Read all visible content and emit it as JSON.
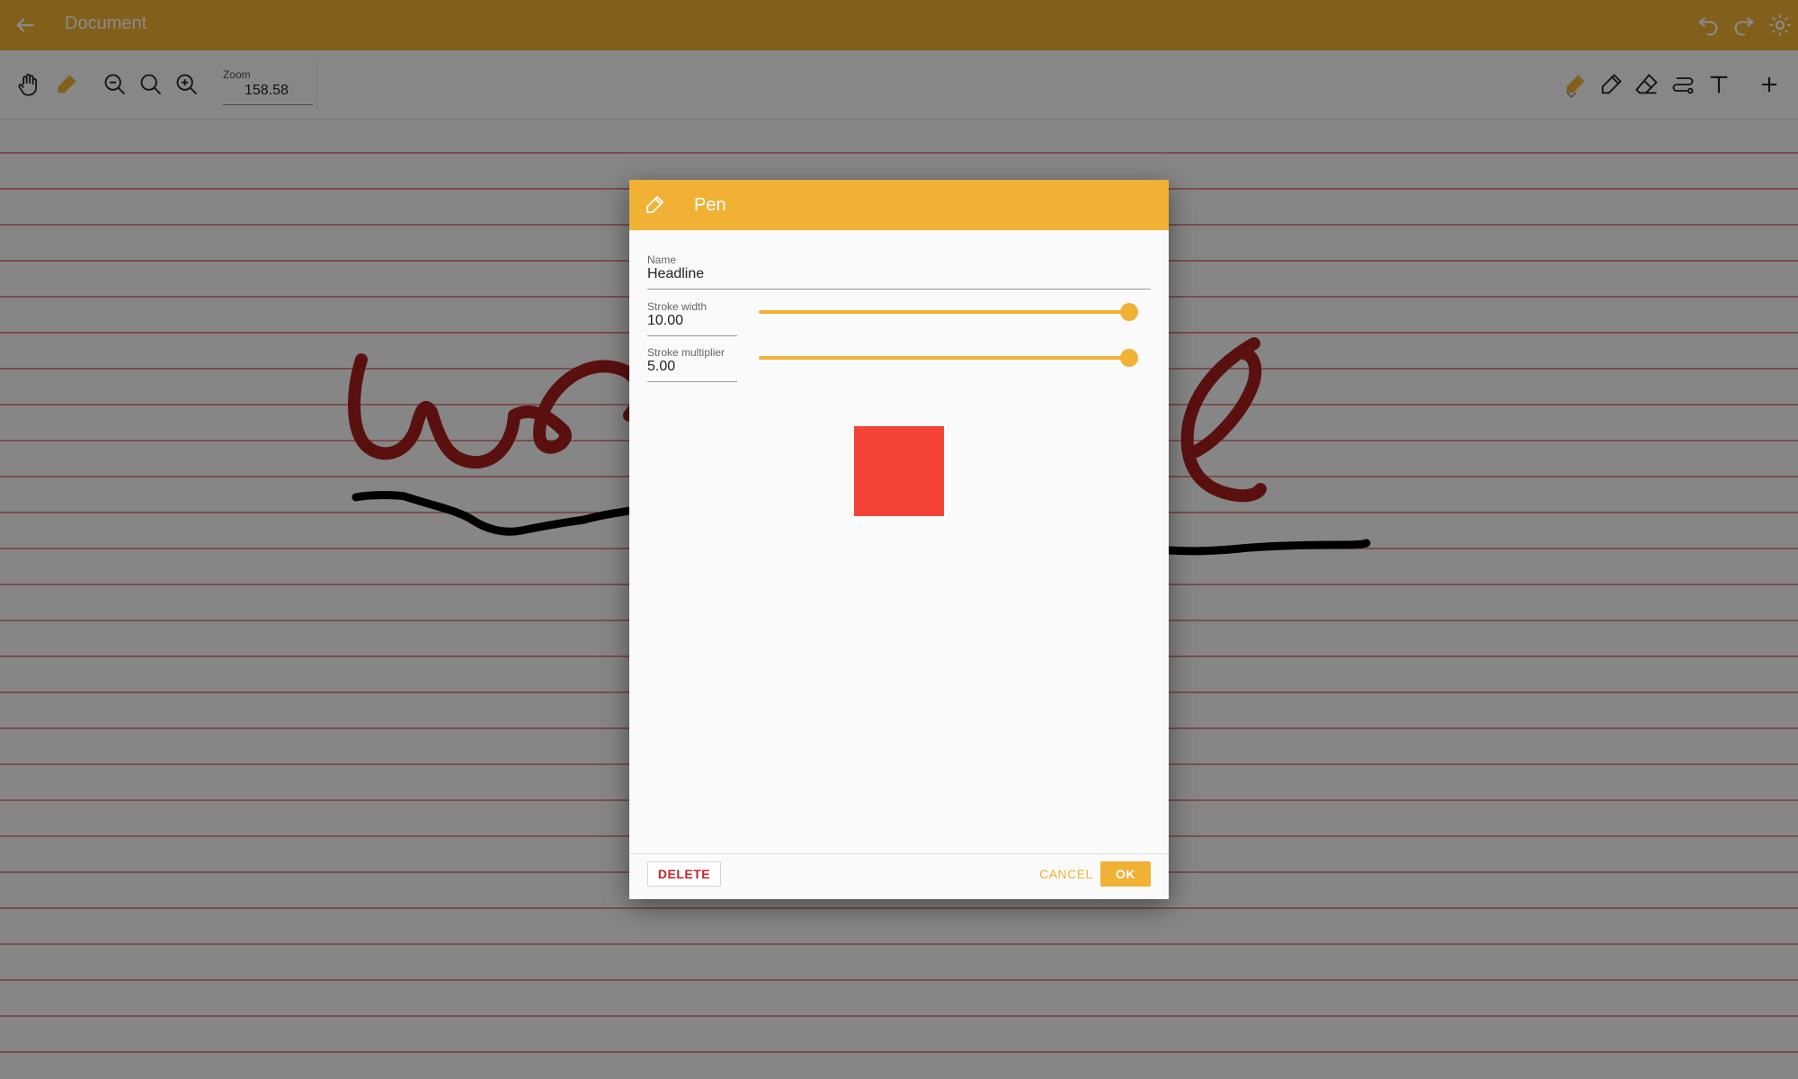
{
  "app_bar": {
    "title": "Document",
    "back_icon": "arrow-left-icon",
    "right_icons": [
      "undo-icon",
      "redo-icon",
      "settings-icon"
    ]
  },
  "toolbar": {
    "left_tools": [
      "hand-icon",
      "pen-icon",
      "zoom-out-icon",
      "zoom-fit-icon",
      "zoom-in-icon"
    ],
    "zoom": {
      "label": "Zoom",
      "value": "158.58"
    },
    "right_tools": [
      "pen-icon",
      "pencil-icon",
      "eraser-icon",
      "lasso-icon",
      "text-icon",
      "add-icon"
    ]
  },
  "dialog": {
    "title": "Pen",
    "header_icon": "pencil-icon",
    "name": {
      "label": "Name",
      "value": "Headline"
    },
    "stroke_width": {
      "label": "Stroke width",
      "value": "10.00",
      "slider_fraction": 1.0
    },
    "stroke_multiplier": {
      "label": "Stroke multiplier",
      "value": "5.00",
      "slider_fraction": 1.0
    },
    "color": "#f44336",
    "buttons": {
      "delete": "DELETE",
      "cancel": "CANCEL",
      "ok": "OK"
    }
  },
  "colors": {
    "accent": "#f0b135",
    "ruling_line": "#e06f6f",
    "ink_red": "#a81f1f",
    "ink_black": "#000000",
    "delete_text": "#c0262b"
  }
}
